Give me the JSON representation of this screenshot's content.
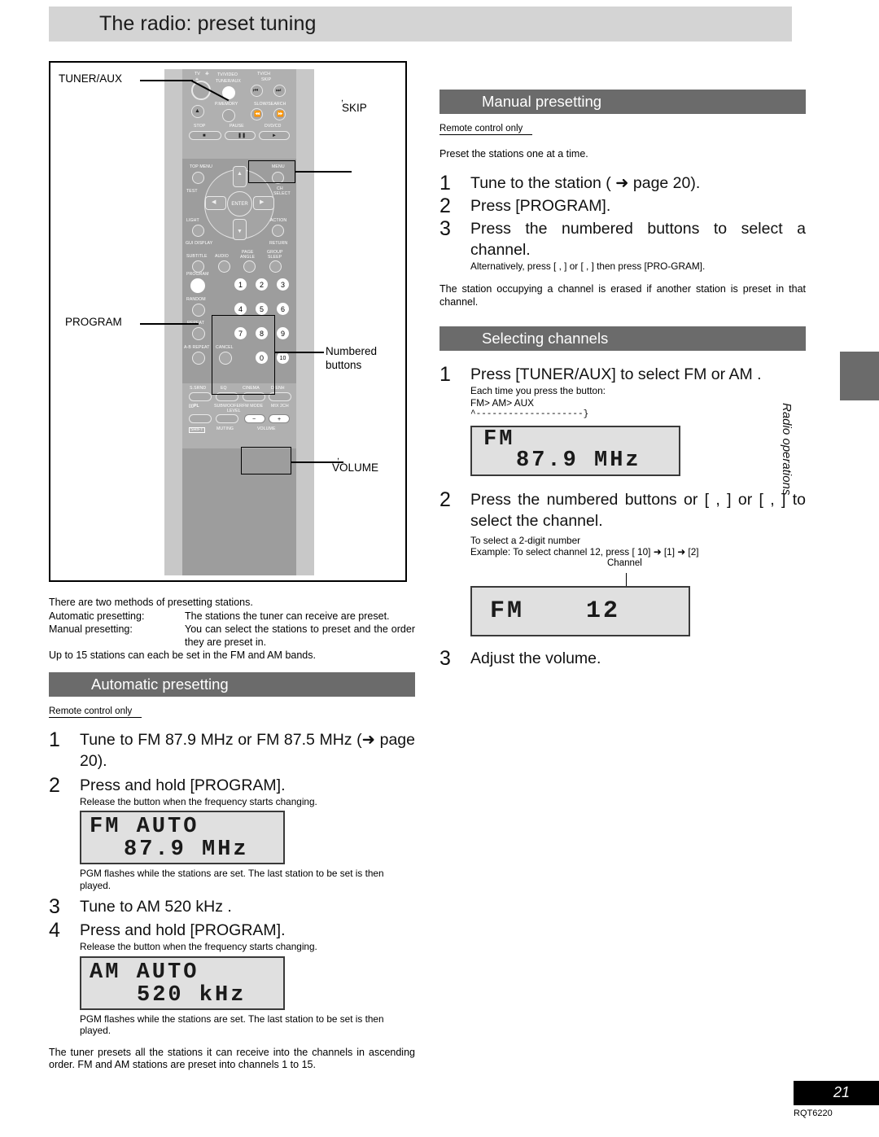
{
  "page": {
    "title": "The radio: preset tuning",
    "page_number": "21",
    "doc_code": "RQT6220",
    "side_tab_label": "Radio operations"
  },
  "colors": {
    "header_bar": "#d4d4d4",
    "section_bar": "#6b6b6b",
    "remote_body": "#c8c8c8",
    "remote_inner": "#9d9d9d",
    "lcd_bg": "#e0e0e0",
    "page_box": "#000000"
  },
  "remote": {
    "callouts": [
      {
        "name": "tuner-aux",
        "label": "TUNER/AUX"
      },
      {
        "name": "skip",
        "label": "SKIP"
      },
      {
        "name": "program",
        "label": "PROGRAM"
      },
      {
        "name": "numbered-buttons",
        "label": "Numbered\nbuttons"
      },
      {
        "name": "volume",
        "label": "VOLUME"
      }
    ],
    "callout_text": {
      "tuner_aux": "TUNER/AUX",
      "skip": "SKIP",
      "program": "PROGRAM",
      "numbered_line1": "Numbered",
      "numbered_line2": "buttons",
      "volume": "VOLUME"
    },
    "button_labels": {
      "tv_power": "TV",
      "tv_video": "TV/VIDEO",
      "tuner_aux": "TUNER/AUX",
      "tv_ch": "TV/CH",
      "skip": "SKIP",
      "p_memory": "P.MEMORY",
      "slow_search": "SLOW/SEARCH",
      "stop": "STOP",
      "pause": "PAUSE",
      "dvd_cd": "DVD/CD",
      "top_menu": "TOP MENU",
      "menu": "MENU",
      "test": "TEST",
      "ch_select_1": "CH",
      "ch_select_2": "SELECT",
      "enter": "ENTER",
      "light": "LIGHT",
      "action": "ACTION",
      "gui_display": "GUI DISPLAY",
      "return": "RETURN",
      "subtitle": "SUBTITLE",
      "audio": "AUDIO",
      "page": "PAGE",
      "angle": "ANGLE",
      "group": "GROUP",
      "sleep": "SLEEP",
      "program": "PROGRAM",
      "random": "RANDOM",
      "repeat": "REPEAT",
      "ab_repeat": "A-B REPEAT",
      "cancel": "CANCEL",
      "s_srnd": "S.SRND",
      "eq": "EQ",
      "cinema": "CINEMA",
      "d_enh": "D.ENH",
      "dolby_pl": "PL",
      "subwoofer": "SUBWOOFER",
      "level": "LEVEL",
      "fm_mode": "FM MODE",
      "mix_2ch": "MIX 2CH",
      "shift": "SHIFT",
      "muting": "MUTING",
      "volume": "VOLUME",
      "vol_minus": "−",
      "vol_plus": "+"
    },
    "numbered_buttons": [
      "1",
      "2",
      "3",
      "4",
      "5",
      "6",
      "7",
      "8",
      "9",
      "0",
      "10"
    ]
  },
  "intro": {
    "line1": "There are two methods of presetting stations.",
    "auto_label": "Automatic presetting:",
    "auto_desc": "The stations the tuner can receive are preset.",
    "manual_label": "Manual presetting:",
    "manual_desc": "You can select the stations to preset and the order they are preset in.",
    "line_last": "Up to 15 stations can each be set in the FM and AM bands."
  },
  "automatic": {
    "heading": "Automatic presetting",
    "remote_only": "Remote control only",
    "steps": [
      {
        "num": "1",
        "text": "Tune to  FM 87.9 MHz  or  FM 87.5 MHz  (➜ page 20)."
      },
      {
        "num": "2",
        "text": "Press and hold [PROGRAM].",
        "sub": "Release the button when the frequency starts changing.",
        "display": {
          "line1": "FM AUTO",
          "line2": "87.9 MHz"
        },
        "note": " PGM  flashes while the stations are set. The last station to be set is then played."
      },
      {
        "num": "3",
        "text": "Tune to   AM 520 kHz  ."
      },
      {
        "num": "4",
        "text": "Press and hold [PROGRAM].",
        "sub": "Release the button when the frequency starts changing.",
        "display": {
          "line1": "AM AUTO",
          "line2": "520 kHz"
        },
        "note": " PGM  flashes while the stations are set. The last station to be set is then played."
      }
    ],
    "footer": "The tuner presets all the stations it can receive into the channels in ascending order. FM and AM stations are preset into channels 1 to 15."
  },
  "manual": {
    "heading": "Manual presetting",
    "remote_only": "Remote control only",
    "intro": "Preset the stations one at a time.",
    "steps": [
      {
        "num": "1",
        "text": "Tune to the station (  ➜ page 20)."
      },
      {
        "num": "2",
        "text": "Press [PROGRAM]."
      },
      {
        "num": "3",
        "text": "Press the numbered buttons to select a channel.",
        "sub": "Alternatively, press [      ,    ] or [      ,    ] then press [PRO-GRAM]."
      }
    ],
    "footer": "The station occupying a channel is erased if another station is preset in that channel."
  },
  "selecting": {
    "heading": "Selecting channels",
    "steps": [
      {
        "num": "1",
        "text": "Press [TUNER/AUX] to select    FM  or  AM  .",
        "sub1": "Each time you press the button:",
        "sub2": "FM>  AM>  AUX",
        "sub3": "  ^--------------------}",
        "display": {
          "line1": "FM",
          "line2": "87.9 MHz"
        }
      },
      {
        "num": "2",
        "text": "Press the numbered buttons or [      ,    ] or [      ,    ] to select the channel.",
        "sub1": "To select a 2-digit number",
        "sub2": "Example:  To select channel 12, press [   10] ➜ [1] ➜ [2]",
        "caption": "Channel",
        "display": {
          "line1": "FM",
          "line2": "12"
        }
      },
      {
        "num": "3",
        "text": "Adjust the volume."
      }
    ]
  }
}
